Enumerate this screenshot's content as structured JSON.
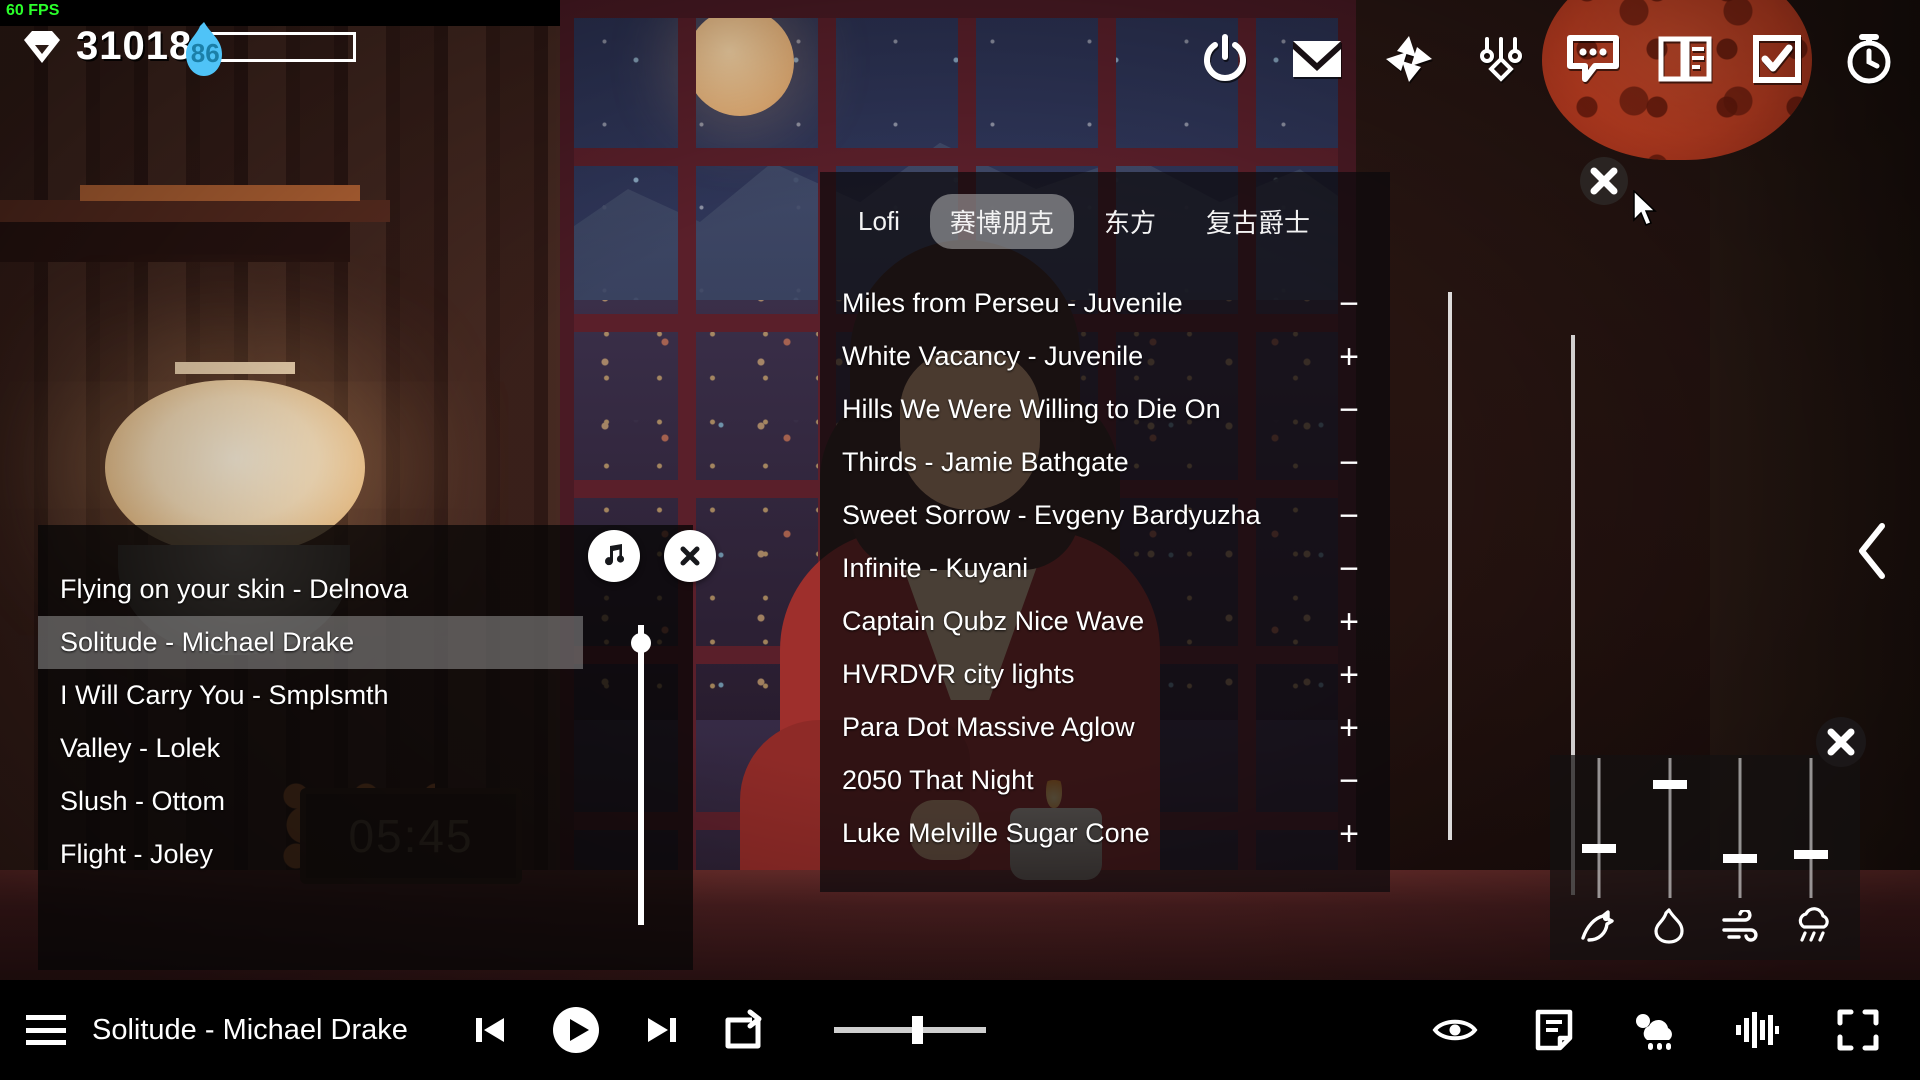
{
  "hud": {
    "fps_label": "60 FPS",
    "gem_icon": "gem-icon",
    "gem_count": "31018",
    "energy_icon": "flame-icon",
    "energy_value": "86"
  },
  "top_icons": [
    {
      "name": "power-icon",
      "label": "Power"
    },
    {
      "name": "mail-icon",
      "label": "Mail"
    },
    {
      "name": "shutter-icon",
      "label": "Screenshot"
    },
    {
      "name": "sliders-icon",
      "label": "Settings"
    },
    {
      "name": "chat-icon",
      "label": "Chat"
    },
    {
      "name": "book-icon",
      "label": "Journal"
    },
    {
      "name": "checklist-icon",
      "label": "Tasks"
    },
    {
      "name": "timer-icon",
      "label": "Timer"
    }
  ],
  "music_panel": {
    "tabs": [
      {
        "label": "Lofi",
        "active": false
      },
      {
        "label": "赛博朋克",
        "active": true
      },
      {
        "label": "东方",
        "active": false
      },
      {
        "label": "复古爵士",
        "active": false
      }
    ],
    "tracks": [
      {
        "title": "Miles from Perseu - Juvenile",
        "toggle": "−"
      },
      {
        "title": "White Vacancy - Juvenile",
        "toggle": "+"
      },
      {
        "title": "Hills We Were Willing to Die On",
        "toggle": "−"
      },
      {
        "title": "Thirds - Jamie Bathgate",
        "toggle": "−"
      },
      {
        "title": "Sweet Sorrow - Evgeny Bardyuzha",
        "toggle": "−"
      },
      {
        "title": "Infinite - Kuyani",
        "toggle": "−"
      },
      {
        "title": "Captain Qubz Nice Wave",
        "toggle": "+"
      },
      {
        "title": "HVRDVR city lights",
        "toggle": "+"
      },
      {
        "title": "Para Dot Massive Aglow",
        "toggle": "+"
      },
      {
        "title": "2050 That Night",
        "toggle": "−"
      },
      {
        "title": "Luke Melville Sugar Cone",
        "toggle": "+"
      }
    ],
    "float_buttons": [
      {
        "name": "music-note-button",
        "glyph": "♫"
      },
      {
        "name": "close-button",
        "glyph": "✕"
      }
    ]
  },
  "playlist_panel": {
    "items": [
      {
        "title": "Flying on your skin - Delnova",
        "selected": false
      },
      {
        "title": "Solitude - Michael Drake",
        "selected": true
      },
      {
        "title": "I Will Carry You - Smplsmth",
        "selected": false
      },
      {
        "title": "Valley - Lolek",
        "selected": false
      },
      {
        "title": "Slush - Ottom",
        "selected": false
      },
      {
        "title": "Flight - Joley",
        "selected": false
      }
    ]
  },
  "ambience_mixer": {
    "channels": [
      {
        "name": "bird-icon",
        "label": "Birds",
        "level": 42
      },
      {
        "name": "fire-icon",
        "label": "Fire",
        "level": 78
      },
      {
        "name": "wind-icon",
        "label": "Wind",
        "level": 30
      },
      {
        "name": "rain-icon",
        "label": "Rain",
        "level": 34
      }
    ],
    "close_label": "✕"
  },
  "player_bar": {
    "menu_icon": "hamburger-icon",
    "now_playing": "Solitude - Michael Drake",
    "controls": [
      {
        "name": "previous-track-button",
        "label": "Previous"
      },
      {
        "name": "play-button",
        "label": "Play"
      },
      {
        "name": "next-track-button",
        "label": "Next"
      },
      {
        "name": "repeat-button",
        "label": "Repeat"
      }
    ],
    "progress_percent": 52,
    "right_icons": [
      {
        "name": "eye-icon",
        "label": "Hide UI"
      },
      {
        "name": "note-icon",
        "label": "Notes"
      },
      {
        "name": "weather-icon",
        "label": "Weather"
      },
      {
        "name": "equalizer-icon",
        "label": "Equalizer"
      },
      {
        "name": "fullscreen-icon",
        "label": "Fullscreen"
      }
    ]
  },
  "scene": {
    "clock_time": "05:45",
    "chevron_right": "‹"
  },
  "colors": {
    "fps_green": "#2bff2b",
    "energy_blue": "#1b7fa8",
    "lantern_orange": "#ef8a42",
    "red_lantern": "#e24a28",
    "accent_white": "#ffffff"
  }
}
